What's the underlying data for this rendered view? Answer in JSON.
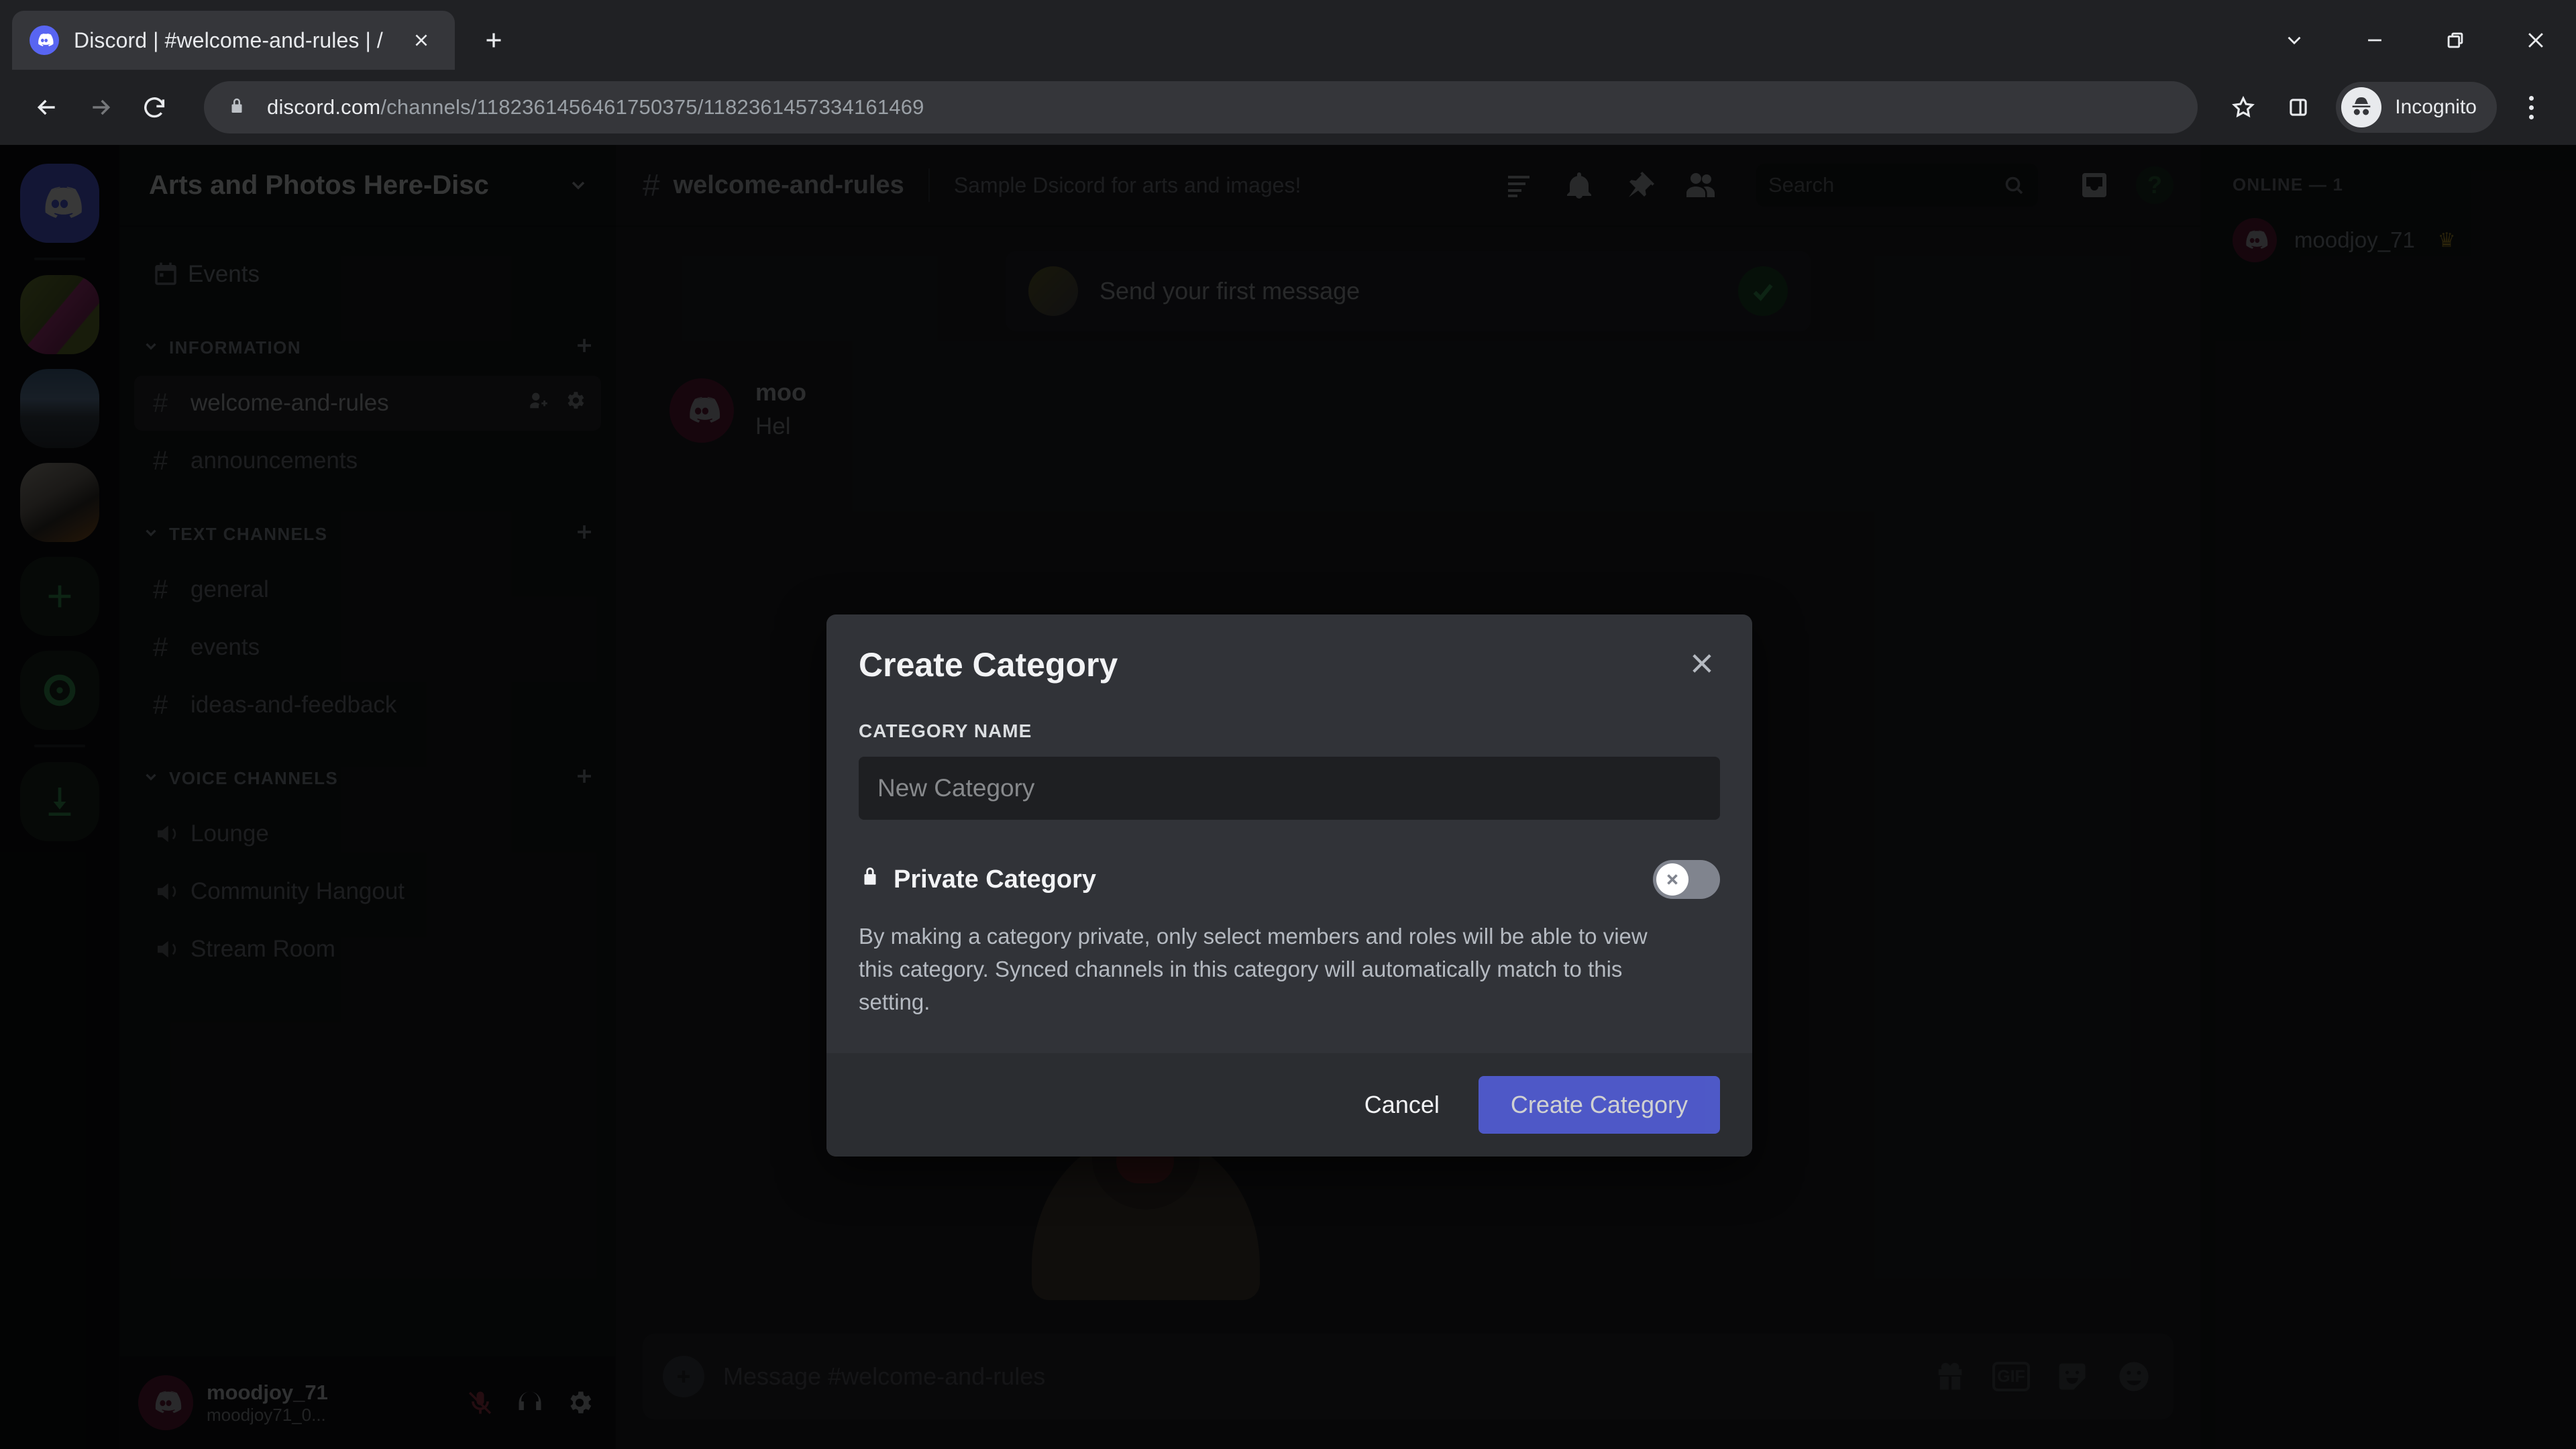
{
  "browser": {
    "tab": {
      "title": "Discord | #welcome-and-rules | /",
      "favicon": "discord-icon"
    },
    "new_tab_label": "+",
    "window_controls": [
      "chevron-down",
      "minimize",
      "restore",
      "close"
    ],
    "url_host": "discord.com",
    "url_path": "/channels/1182361456461750375/1182361457334161469",
    "profile_label": "Incognito"
  },
  "discord": {
    "server_rail": [
      {
        "name": "home",
        "type": "logo"
      },
      {
        "name": "server-1",
        "type": "image"
      },
      {
        "name": "server-2",
        "type": "image"
      },
      {
        "name": "server-3",
        "type": "image"
      },
      {
        "name": "add-server",
        "type": "plus"
      },
      {
        "name": "explore-servers",
        "type": "compass"
      },
      {
        "name": "download-apps",
        "type": "download"
      }
    ],
    "server_name": "Arts and Photos Here-Disc",
    "nav": {
      "events_label": "Events"
    },
    "categories": [
      {
        "label": "INFORMATION",
        "channels": [
          {
            "name": "welcome-and-rules",
            "type": "text",
            "active": true
          },
          {
            "name": "announcements",
            "type": "text",
            "active": false
          }
        ]
      },
      {
        "label": "TEXT CHANNELS",
        "channels": [
          {
            "name": "general",
            "type": "text",
            "active": false
          },
          {
            "name": "events",
            "type": "text",
            "active": false
          },
          {
            "name": "ideas-and-feedback",
            "type": "text",
            "active": false
          }
        ]
      },
      {
        "label": "VOICE CHANNELS",
        "channels": [
          {
            "name": "Lounge",
            "type": "voice",
            "active": false
          },
          {
            "name": "Community Hangout",
            "type": "voice",
            "active": false
          },
          {
            "name": "Stream Room",
            "type": "voice",
            "active": false
          }
        ]
      }
    ],
    "user_panel": {
      "username": "moodjoy_71",
      "handle": "moodjoy71_0...",
      "icons": [
        "microphone-muted-icon",
        "headphones-icon",
        "gear-icon"
      ]
    },
    "channel_header": {
      "hash": "#",
      "channel_name": "welcome-and-rules",
      "topic": "Sample Dsicord for arts and images!",
      "icons": [
        "threads-icon",
        "bell-icon",
        "pin-icon",
        "members-icon",
        "inbox-icon",
        "help-icon"
      ],
      "search_placeholder": "Search"
    },
    "onboarding": {
      "text": "Send your first message",
      "completed": true
    },
    "message": {
      "author": "moo",
      "text": "Hel"
    },
    "composer": {
      "placeholder": "Message #welcome-and-rules",
      "icons": [
        "gift-icon",
        "gif-icon",
        "sticker-icon",
        "emoji-icon"
      ],
      "gif_label": "GIF"
    },
    "members": {
      "group_label": "ONLINE — 1",
      "list": [
        {
          "name": "moodjoy_71",
          "owner": true,
          "crown": "♛"
        }
      ]
    }
  },
  "modal": {
    "title": "Create Category",
    "close_icon": "close-icon",
    "field_label": "CATEGORY NAME",
    "input_placeholder": "New Category",
    "toggle_label": "Private Category",
    "toggle_icon": "lock-icon",
    "toggle_state": "off",
    "helper_text": "By making a category private, only select members and roles will be able to view this category. Synced channels in this category will automatically match to this setting.",
    "cancel_label": "Cancel",
    "submit_label": "Create Category",
    "accent_color": "#5865f2"
  }
}
